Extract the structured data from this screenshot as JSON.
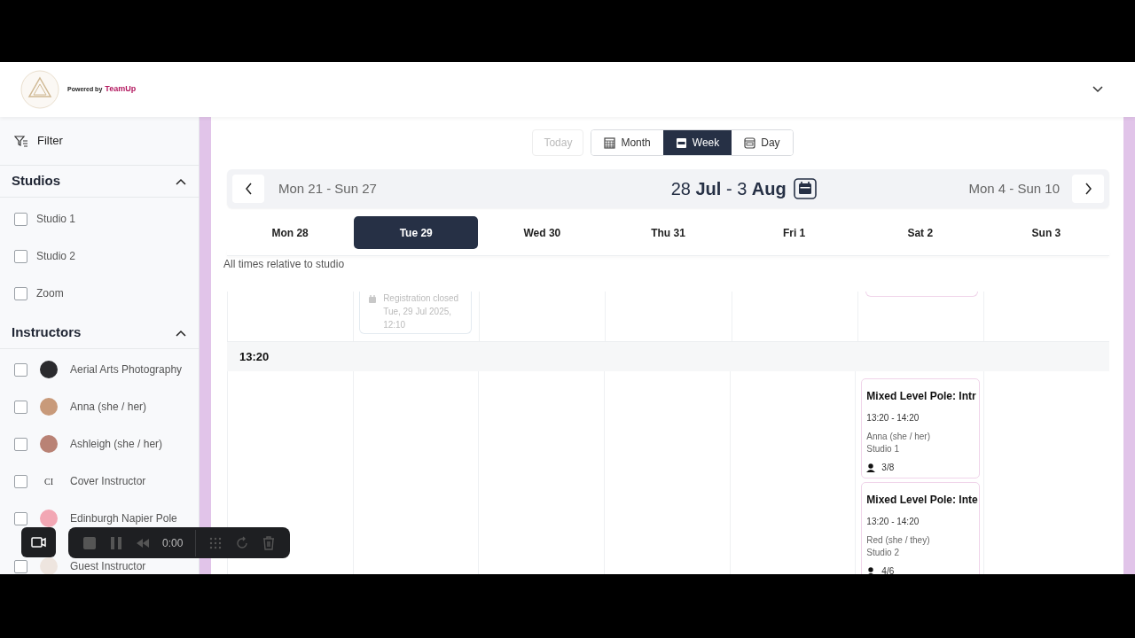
{
  "header": {
    "powered_by": "Powered by",
    "brand": "TeamUp"
  },
  "sidebar": {
    "filter_label": "Filter",
    "sections": [
      {
        "title": "Studios",
        "expanded": true,
        "items": [
          {
            "label": "Studio 1",
            "checked": false
          },
          {
            "label": "Studio 2",
            "checked": false
          },
          {
            "label": "Zoom",
            "checked": false
          }
        ]
      },
      {
        "title": "Instructors",
        "expanded": true,
        "items": [
          {
            "label": "Aerial Arts Photography",
            "checked": false,
            "avatar": {
              "kind": "photo",
              "color": "#2b2b2e"
            }
          },
          {
            "label": "Anna (she / her)",
            "checked": false,
            "avatar": {
              "kind": "photo",
              "color": "#c89a7a"
            }
          },
          {
            "label": "Ashleigh (she / her)",
            "checked": false,
            "avatar": {
              "kind": "photo",
              "color": "#b98275"
            }
          },
          {
            "label": "Cover Instructor",
            "checked": false,
            "avatar": {
              "kind": "initials",
              "text": "CI"
            }
          },
          {
            "label": "Edinburgh Napier Pole",
            "checked": false,
            "avatar": {
              "kind": "photo",
              "color": "#f2a7b4"
            }
          },
          {
            "label": "Guest Instructor",
            "checked": false,
            "avatar": {
              "kind": "photo",
              "color": "#eee5df"
            }
          }
        ]
      }
    ]
  },
  "toolbar": {
    "today": {
      "label": "Today",
      "disabled": true
    },
    "views": [
      {
        "label": "Month",
        "selected": false
      },
      {
        "label": "Week",
        "selected": true
      },
      {
        "label": "Day",
        "selected": false
      }
    ]
  },
  "range_nav": {
    "previous": "Mon 21 - Sun 27",
    "current": "28 **Jul** - 3 **Aug**",
    "next": "Mon 4 - Sun 10"
  },
  "days": [
    {
      "label": "Mon 28",
      "selected": false
    },
    {
      "label": "Tue 29",
      "selected": true,
      "earlier_events": [
        {
          "kind": "closed",
          "lines": [
            "Registration closed",
            "Tue, 29 Jul 2025,",
            "12:10"
          ]
        }
      ]
    },
    {
      "label": "Wed 30",
      "selected": false
    },
    {
      "label": "Thu 31",
      "selected": false
    },
    {
      "label": "Fri 1",
      "selected": false
    },
    {
      "label": "Sat 2",
      "selected": false,
      "earlier_events": [
        {
          "kind": "clipped"
        }
      ],
      "events": [
        {
          "title": "Mixed Level Pole: Intr",
          "time": "13:20 - 14:20",
          "instructor": "Anna (she / her)",
          "studio": "Studio 1",
          "spots": "3/8"
        },
        {
          "title": "Mixed Level Pole: Inte",
          "time": "13:20 - 14:20",
          "instructor": "Red (she / they)",
          "studio": "Studio 2",
          "spots": "4/6"
        }
      ]
    },
    {
      "label": "Sun 3",
      "selected": false
    }
  ],
  "note": "All times relative to studio",
  "time_slot": "13:20",
  "recorder": {
    "time": "0:00"
  }
}
